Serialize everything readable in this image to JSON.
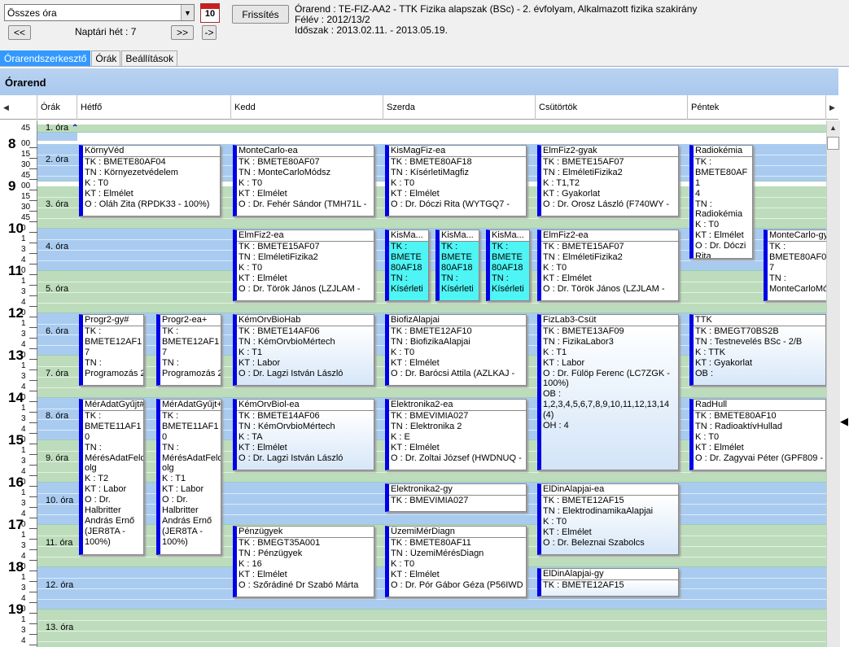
{
  "toolbar": {
    "filter_value": "Összes óra",
    "refresh_label": "Frissítés",
    "prev_label": "<<",
    "next_label": ">>",
    "jump_label": "->",
    "week_label": "Naptári hét : 7",
    "calendar_day": "10"
  },
  "info": {
    "line1": "Órarend : TE-FIZ-AA2 - TTK Fizika alapszak (BSc) - 2. évfolyam, Alkalmazott fizika szakirány",
    "line2": "Félév : 2012/13/2",
    "line3": "Időszak : 2013.02.11. - 2013.05.19."
  },
  "tabs": [
    "Órarendszerkesztő",
    "Órák",
    "Beállítások"
  ],
  "panel_title": "Órarend",
  "columns": [
    "Órák",
    "Hétfő",
    "Kedd",
    "Szerda",
    "Csütörtök",
    "Péntek"
  ],
  "periods": [
    "1. óra",
    "2. óra",
    "3. óra",
    "4. óra",
    "5. óra",
    "6. óra",
    "7. óra",
    "8. óra",
    "9. óra",
    "10. óra",
    "11. óra",
    "12. óra",
    "13. óra"
  ],
  "hours": [
    "8",
    "9",
    "10",
    "11",
    "12",
    "13",
    "14",
    "15",
    "16",
    "17",
    "18",
    "19"
  ],
  "minute_labels_a": [
    "15",
    "30",
    "45"
  ],
  "minute_labels_b": [
    "0",
    "1",
    "3",
    "4"
  ],
  "top_minute": "45",
  "events": [
    {
      "title": "KörnyVéd",
      "lines": [
        "TK : BMETE80AF04",
        "TN : Környezetvédelem",
        "K : T0",
        "KT : Elmélet",
        "O : Oláh Zita (RPDK33 - 100%)"
      ]
    },
    {
      "title": "MonteCarlo-ea",
      "lines": [
        "TK : BMETE80AF07",
        "TN : MonteCarloMódsz",
        "K : T0",
        "KT : Elmélet",
        "O : Dr. Fehér Sándor (TMH71L -"
      ]
    },
    {
      "title": "KisMagFiz-ea",
      "lines": [
        "TK : BMETE80AF18",
        "TN : KísérletiMagfiz",
        "K : T0",
        "KT : Elmélet",
        "O : Dr. Dóczi Rita (WYTGQ7 -"
      ]
    },
    {
      "title": "ElmFiz2-gyak",
      "lines": [
        "TK : BMETE15AF07",
        "TN : ElméletiFizika2",
        "K : T1,T2",
        "KT : Gyakorlat",
        "O : Dr. Orosz László (F740WY -"
      ]
    },
    {
      "title": "Radiokémia",
      "lines": [
        "TK :",
        "BMETE80AF1",
        "4",
        "TN :",
        "Radiokémia",
        "K : T0",
        "KT : Elmélet",
        "O : Dr. Dóczi",
        "Rita"
      ]
    },
    {
      "title": "ElmFiz2-ea",
      "lines": [
        "TK : BMETE15AF07",
        "TN : ElméletiFizika2",
        "K : T0",
        "KT : Elmélet",
        "O : Dr. Török János (LZJLAM -"
      ]
    },
    {
      "title": "KisMa...",
      "lines": [
        "TK :",
        "BMETE",
        "80AF18",
        "TN :",
        "Kísérleti"
      ]
    },
    {
      "title": "KisMa...",
      "lines": [
        "TK :",
        "BMETE",
        "80AF18",
        "TN :",
        "Kísérleti"
      ]
    },
    {
      "title": "KisMa...",
      "lines": [
        "TK :",
        "BMETE",
        "80AF18",
        "TN :",
        "Kísérleti"
      ]
    },
    {
      "title": "ElmFiz2-ea",
      "lines": [
        "TK : BMETE15AF07",
        "TN : ElméletiFizika2",
        "K : T0",
        "KT : Elmélet",
        "O : Dr. Török János (LZJLAM -"
      ]
    },
    {
      "title": "MonteCarlo-gy",
      "lines": [
        "TK :",
        "BMETE80AF0",
        "7",
        "TN :",
        "MonteCarloMó"
      ]
    },
    {
      "title": "Progr2-gy#",
      "lines": [
        "TK :",
        "BMETE12AF1",
        "7",
        "TN :",
        "Programozás 2"
      ]
    },
    {
      "title": "Progr2-ea+",
      "lines": [
        "TK :",
        "BMETE12AF1",
        "7",
        "TN :",
        "Programozás 2"
      ]
    },
    {
      "title": "KémOrvBioHab",
      "lines": [
        "TK : BMETE14AF06",
        "TN : KémOrvbioMértech",
        "K : T1",
        "KT : Labor",
        "O : Dr. Lagzi István László"
      ]
    },
    {
      "title": "BiofizAlapjai",
      "lines": [
        "TK : BMETE12AF10",
        "TN : BiofizikaAlapjai",
        "K : T0",
        "KT : Elmélet",
        "O : Dr. Barócsi Attila (AZLKAJ -"
      ]
    },
    {
      "title": "FizLab3-Csüt",
      "lines": [
        "TK : BMETE13AF09",
        "TN : FizikaLabor3",
        "K : T1",
        "KT : Labor",
        "O : Dr. Fülöp Ferenc (LC7ZGK -",
        "100%)",
        "OB :",
        "1,2,3,4,5,6,7,8,9,10,11,12,13,14",
        "(4)",
        "OH : 4"
      ]
    },
    {
      "title": "TTK",
      "lines": [
        "TK : BMEGT70BS2B",
        "TN : Testnevelés BSc - 2/B",
        "K : TTK",
        "KT : Gyakorlat",
        "OB :"
      ]
    },
    {
      "title": "MérAdatGyűjt#",
      "lines": [
        "TK :",
        "BMETE11AF1",
        "0",
        "TN :",
        "MérésAdatFeld",
        "olg",
        "K : T2",
        "KT : Labor",
        "O : Dr.",
        "Halbritter",
        "András Ernő",
        "(JER8TA -",
        "100%)"
      ]
    },
    {
      "title": "MérAdatGyűjt+",
      "lines": [
        "TK :",
        "BMETE11AF1",
        "0",
        "TN :",
        "MérésAdatFeld",
        "olg",
        "K : T1",
        "KT : Labor",
        "O : Dr.",
        "Halbritter",
        "András Ernő",
        "(JER8TA -",
        "100%)"
      ]
    },
    {
      "title": "KémOrvBiol-ea",
      "lines": [
        "TK : BMETE14AF06",
        "TN : KémOrvbioMértech",
        "K : TA",
        "KT : Elmélet",
        "O : Dr. Lagzi István László"
      ]
    },
    {
      "title": "Elektronika2-ea",
      "lines": [
        "TK : BMEVIMIA027",
        "TN : Elektronika 2",
        "K : E",
        "KT : Elmélet",
        "O : Dr. Zoltai József (HWDNUQ -"
      ]
    },
    {
      "title": "RadHull",
      "lines": [
        "TK : BMETE80AF10",
        "TN : RadioaktívHullad",
        "K : T0",
        "KT : Elmélet",
        "O : Dr. Zagyvai Péter (GPF809 -"
      ]
    },
    {
      "title": "Elektronika2-gy",
      "lines": [
        "TK : BMEVIMIA027"
      ]
    },
    {
      "title": "ElDinAlapjai-ea",
      "lines": [
        "TK : BMETE12AF15",
        "TN : ElektrodinamikaAlapjai",
        "K : T0",
        "KT : Elmélet",
        "O : Dr. Beleznai Szabolcs"
      ]
    },
    {
      "title": "Pénzügyek",
      "lines": [
        "TK : BMEGT35A001",
        "TN : Pénzügyek",
        "K : 16",
        "KT : Elmélet",
        "O : Szőrádiné Dr Szabó Márta"
      ]
    },
    {
      "title": "ÜzemiMérDiagn",
      "lines": [
        "TK : BMETE80AF11",
        "TN : ÜzemiMérésDiagn",
        "K : T0",
        "KT : Elmélet",
        "O : Dr. Pór Gábor Géza (P56IWD"
      ]
    },
    {
      "title": "ElDinAlapjai-gy",
      "lines": [
        "TK : BMETE12AF15"
      ]
    }
  ]
}
